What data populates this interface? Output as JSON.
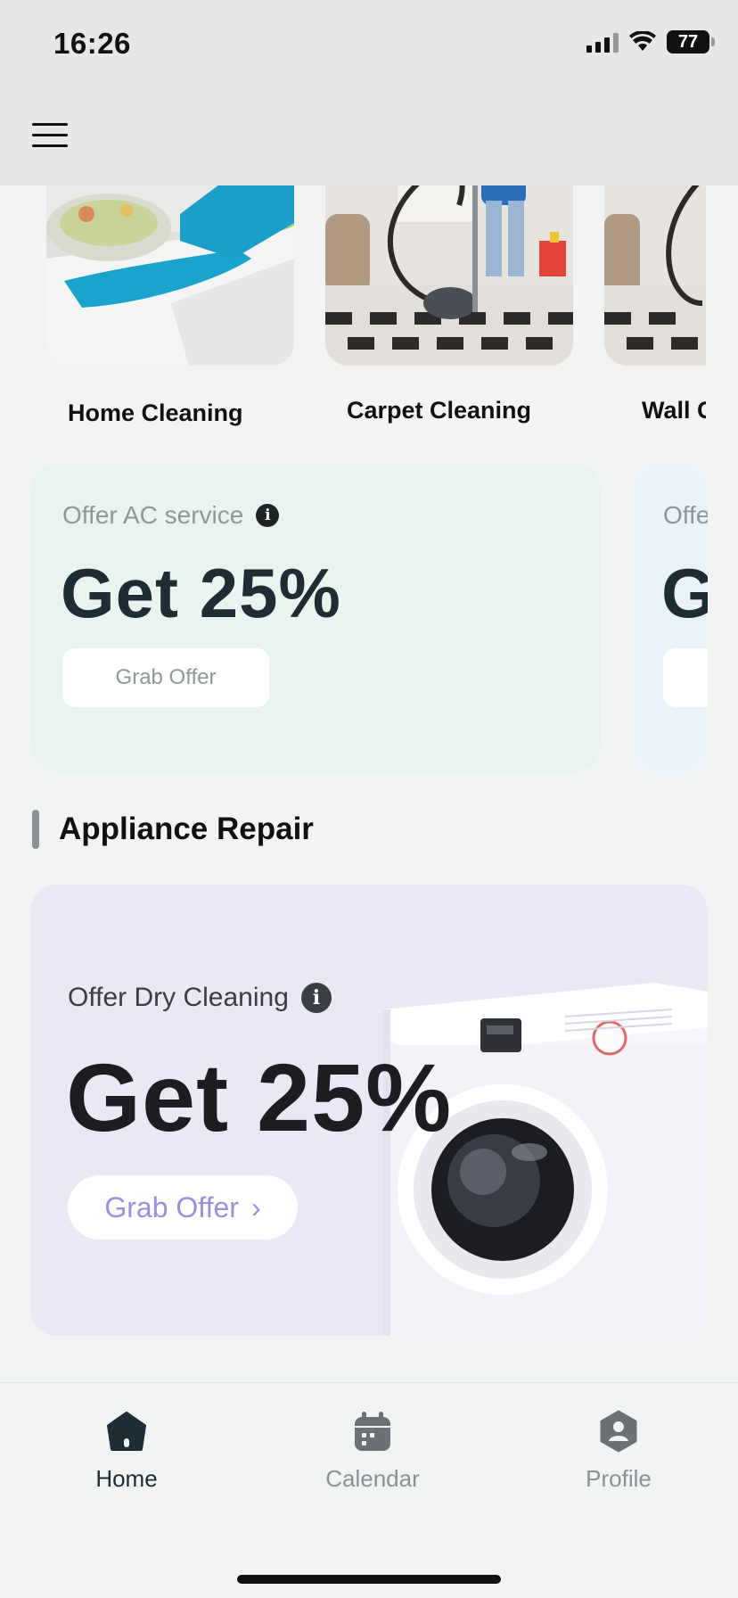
{
  "status_bar": {
    "time": "16:26",
    "battery": "77"
  },
  "header": {
    "menu_icon": "hamburger-menu-icon"
  },
  "categories": [
    {
      "label": "Home Cleaning"
    },
    {
      "label": "Carpet Cleaning"
    },
    {
      "label": "Wall C"
    }
  ],
  "offers": [
    {
      "subtitle": "Offer AC service",
      "headline": "Get 25%",
      "button": "Grab Offer",
      "bg": "#e9f4ef"
    },
    {
      "subtitle": "Offe",
      "headline": "G",
      "button": "",
      "bg": "#e9f3f9"
    }
  ],
  "section": {
    "title": "Appliance Repair"
  },
  "banner": {
    "subtitle": "Offer Dry Cleaning",
    "headline": "Get 25%",
    "button": "Grab Offer",
    "button_arrow": "›"
  },
  "bottom_nav": {
    "items": [
      {
        "label": "Home",
        "icon": "home-icon",
        "active": true
      },
      {
        "label": "Calendar",
        "icon": "calendar-icon",
        "active": false
      },
      {
        "label": "Profile",
        "icon": "profile-icon",
        "active": false
      }
    ]
  },
  "colors": {
    "accent_dark": "#1e2d33",
    "muted": "#8e979a",
    "banner_button": "#9b8fe0"
  }
}
